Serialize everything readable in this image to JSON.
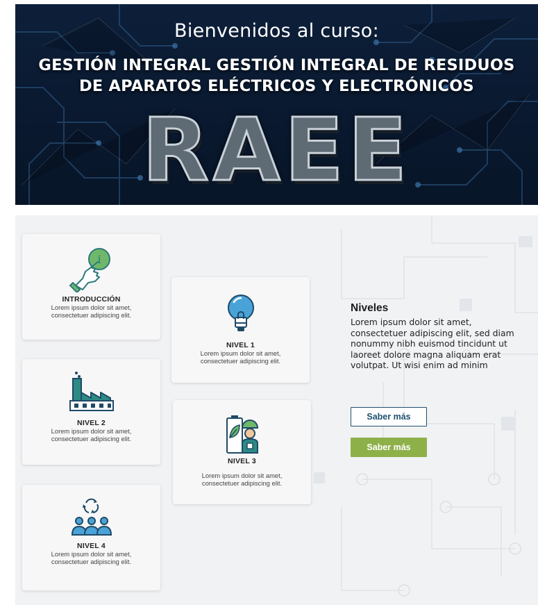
{
  "banner": {
    "welcome": "Bienvenidos al curso:",
    "title_line1": "GESTIÓN INTEGRAL GESTIÓN INTEGRAL DE RESIDUOS",
    "title_line2": "DE APARATOS ELÉCTRICOS Y ELECTRÓNICOS",
    "logo_text": "RAEE"
  },
  "cards": [
    {
      "title": "INTRODUCCIÓN",
      "desc_line1": "Lorem ipsum dolor sit amet,",
      "desc_line2": "consectetuer adipiscing elit.",
      "icon": "hand-pointer-info-icon"
    },
    {
      "title": "NIVEL 1",
      "desc_line1": "Lorem ipsum dolor sit amet,",
      "desc_line2": "consectetuer adipiscing elit.",
      "icon": "lightbulb-icon"
    },
    {
      "title": "NIVEL 2",
      "desc_line1": "Lorem ipsum dolor sit amet,",
      "desc_line2": "consectetuer adipiscing elit.",
      "icon": "factory-icon"
    },
    {
      "title": "NIVEL 3",
      "desc_line1": "Lorem ipsum dolor sit amet,",
      "desc_line2": "consectetuer adipiscing elit.",
      "icon": "battery-worker-icon"
    },
    {
      "title": "NIVEL 4",
      "desc_line1": "Lorem ipsum dolor sit amet,",
      "desc_line2": "consectetuer adipiscing elit.",
      "icon": "recycle-people-icon"
    }
  ],
  "niveles": {
    "title": "Niveles",
    "text": "Lorem ipsum dolor sit amet, consectetuer adipiscing elit, sed diam nonummy nibh euismod tincidunt ut laoreet dolore magna aliquam erat volutpat. Ut wisi enim ad minim",
    "button_outline_label": "Saber más",
    "button_solid_label": "Saber más"
  },
  "colors": {
    "banner_bg": "#0a1a31",
    "panel_bg": "#f1f2f4",
    "icon_teal": "#2d7a7a",
    "icon_green": "#6fb86b",
    "button_outline": "#1f4f6e",
    "button_solid": "#8db049"
  }
}
